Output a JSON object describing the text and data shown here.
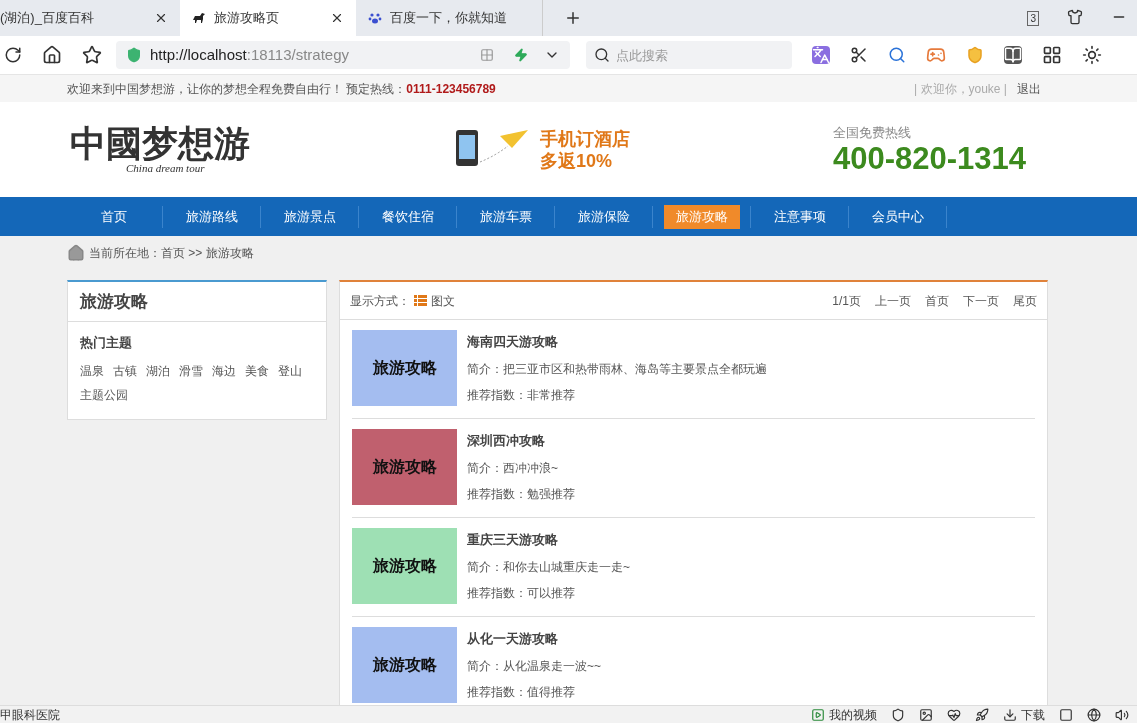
{
  "browser": {
    "tabs": [
      {
        "title": "(湖泊)_百度百科",
        "selected": false
      },
      {
        "title": "旅游攻略页",
        "selected": true
      },
      {
        "title": "百度一下，你就知道",
        "selected": false
      }
    ],
    "tab_count": "3",
    "url_host": "http://localhost",
    "url_rest": ":18113/strategy",
    "search_placeholder": "点此搜索"
  },
  "top_strip": {
    "welcome": "欢迎来到中国梦想游，让你的梦想全程免费自由行！ 预定热线：",
    "hotline": "0111-123456789",
    "user": "| 欢迎你，youke |",
    "logout": "退出"
  },
  "header": {
    "logo": "中國梦想游",
    "logo_sub": "China dream tour",
    "promo_line1": "手机订酒店",
    "promo_line2": "多返10%",
    "phone_label": "全国免费热线",
    "phone": "400-820-1314"
  },
  "nav": [
    {
      "label": "首页",
      "selected": false
    },
    {
      "label": "旅游路线",
      "selected": false
    },
    {
      "label": "旅游景点",
      "selected": false
    },
    {
      "label": "餐饮住宿",
      "selected": false
    },
    {
      "label": "旅游车票",
      "selected": false
    },
    {
      "label": "旅游保险",
      "selected": false
    },
    {
      "label": "旅游攻略",
      "selected": true
    },
    {
      "label": "注意事项",
      "selected": false
    },
    {
      "label": "会员中心",
      "selected": false
    }
  ],
  "breadcrumb": "当前所在地：首页 >> 旅游攻略",
  "sidebar": {
    "title": "旅游攻略",
    "section": "热门主题",
    "tags": [
      "温泉",
      "古镇",
      "湖泊",
      "滑雪",
      "海边",
      "美食",
      "登山",
      "主题公园"
    ]
  },
  "list_header": {
    "display_label": "显示方式：",
    "display_mode": "图文",
    "pager": [
      "1/1页",
      "上一页",
      "首页",
      "下一页",
      "尾页"
    ]
  },
  "articles": [
    {
      "thumb_text": "旅游攻略",
      "color": "#a4bdf0",
      "title": "海南四天游攻略",
      "intro": "简介：把三亚市区和热带雨林、海岛等主要景点全都玩遍",
      "rating": "推荐指数：非常推荐"
    },
    {
      "thumb_text": "旅游攻略",
      "color": "#c0606e",
      "title": "深圳西冲攻略",
      "intro": "简介：西冲冲浪~",
      "rating": "推荐指数：勉强推荐"
    },
    {
      "thumb_text": "旅游攻略",
      "color": "#9ee0b4",
      "title": "重庆三天游攻略",
      "intro": "简介：和你去山城重庆走一走~",
      "rating": "推荐指数：可以推荐"
    },
    {
      "thumb_text": "旅游攻略",
      "color": "#a4bdf0",
      "title": "从化一天游攻略",
      "intro": "简介：从化温泉走一波~~",
      "rating": "推荐指数：值得推荐"
    }
  ],
  "status_bar": {
    "left": "甲眼科医院",
    "video": "我的视频",
    "download": "下载"
  }
}
